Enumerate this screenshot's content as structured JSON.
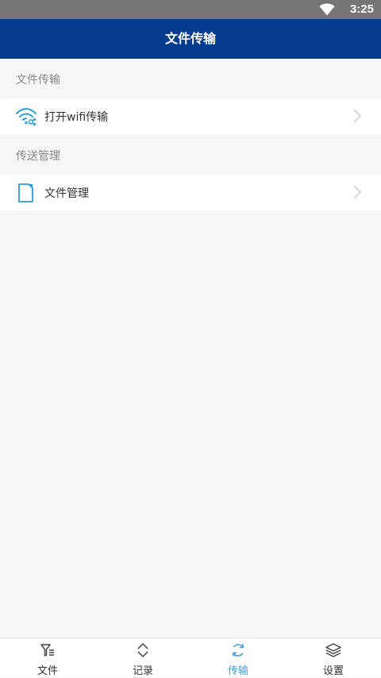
{
  "status_bar": {
    "time": "3:25",
    "wifi_icon": "wifi-icon"
  },
  "header": {
    "title": "文件传输"
  },
  "sections": [
    {
      "title": "文件传输",
      "items": [
        {
          "label": "打开wifi传输",
          "icon": "wifi-transfer-icon"
        }
      ]
    },
    {
      "title": "传送管理",
      "items": [
        {
          "label": "文件管理",
          "icon": "file-icon"
        }
      ]
    }
  ],
  "tab_bar": {
    "active_index": 2,
    "tabs": [
      {
        "label": "文件",
        "icon": "filter-icon"
      },
      {
        "label": "记录",
        "icon": "record-icon"
      },
      {
        "label": "传输",
        "icon": "sync-icon"
      },
      {
        "label": "设置",
        "icon": "layers-icon"
      }
    ]
  },
  "colors": {
    "header_bg": "#043d8f",
    "status_bar_bg": "#757575",
    "accent": "#3a9bdc",
    "page_bg": "#f7f7f7"
  }
}
